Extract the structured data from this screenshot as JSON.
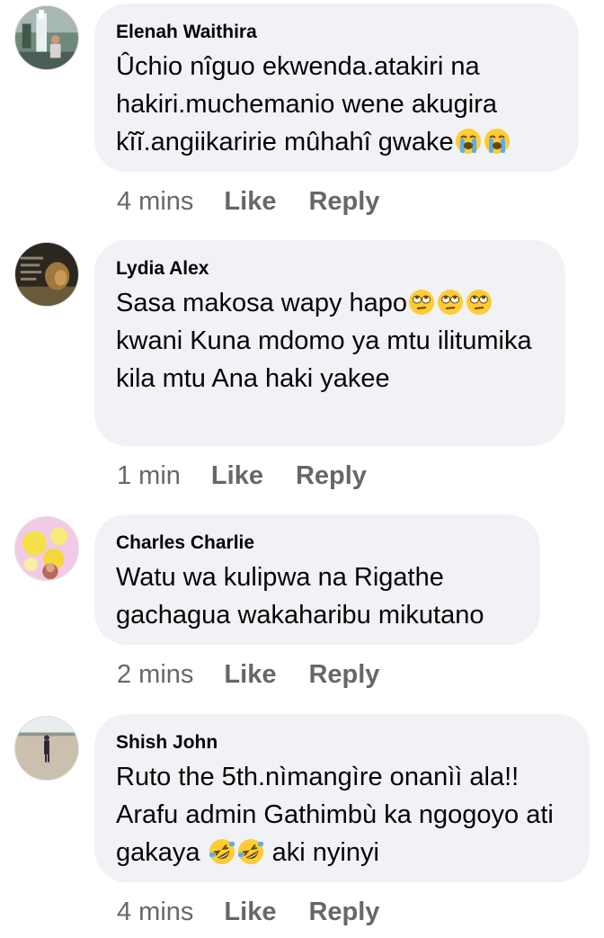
{
  "colors": {
    "bubble_bg": "#f0f2f5",
    "text": "#050505",
    "meta_text": "#65676b"
  },
  "actions": {
    "like_label": "Like",
    "reply_label": "Reply"
  },
  "comments": [
    {
      "author": "Elenah Waithira",
      "avatar_icon": "waterfall-photo-avatar",
      "text_parts": [
        "Ûchio nîguo ekwenda.atakiri na hakiri.muchemanio wene akugira kĩĩ.angiikaririe mûhahî gwake"
      ],
      "emojis": [
        "loudly-crying-face-emoji",
        "loudly-crying-face-emoji"
      ],
      "time": "4 mins"
    },
    {
      "author": "Lydia Alex",
      "avatar_icon": "lion-photo-avatar",
      "text_parts": [
        "Sasa makosa wapy hapo",
        "kwani Kuna mdomo ya mtu ilitumika kila mtu Ana haki yakee"
      ],
      "emojis": [
        "face-with-rolling-eyes-emoji",
        "face-with-rolling-eyes-emoji",
        "face-with-rolling-eyes-emoji"
      ],
      "time": "1 min"
    },
    {
      "author": "Charles Charlie",
      "avatar_icon": "flower-photo-avatar",
      "text_parts": [
        "Watu wa kulipwa na Rigathe gachagua wakaharibu mikutano"
      ],
      "emojis": [],
      "time": "2 mins"
    },
    {
      "author": "Shish John",
      "avatar_icon": "beach-person-photo-avatar",
      "text_parts": [
        "Ruto the 5th.nìmangìre onanìì ala!! Arafu  admin Gathimbù ka  ngogoyo ati gakaya",
        " aki nyinyi"
      ],
      "emojis": [
        "rolling-on-floor-laughing-emoji",
        "rolling-on-floor-laughing-emoji"
      ],
      "time": "4 mins"
    }
  ]
}
